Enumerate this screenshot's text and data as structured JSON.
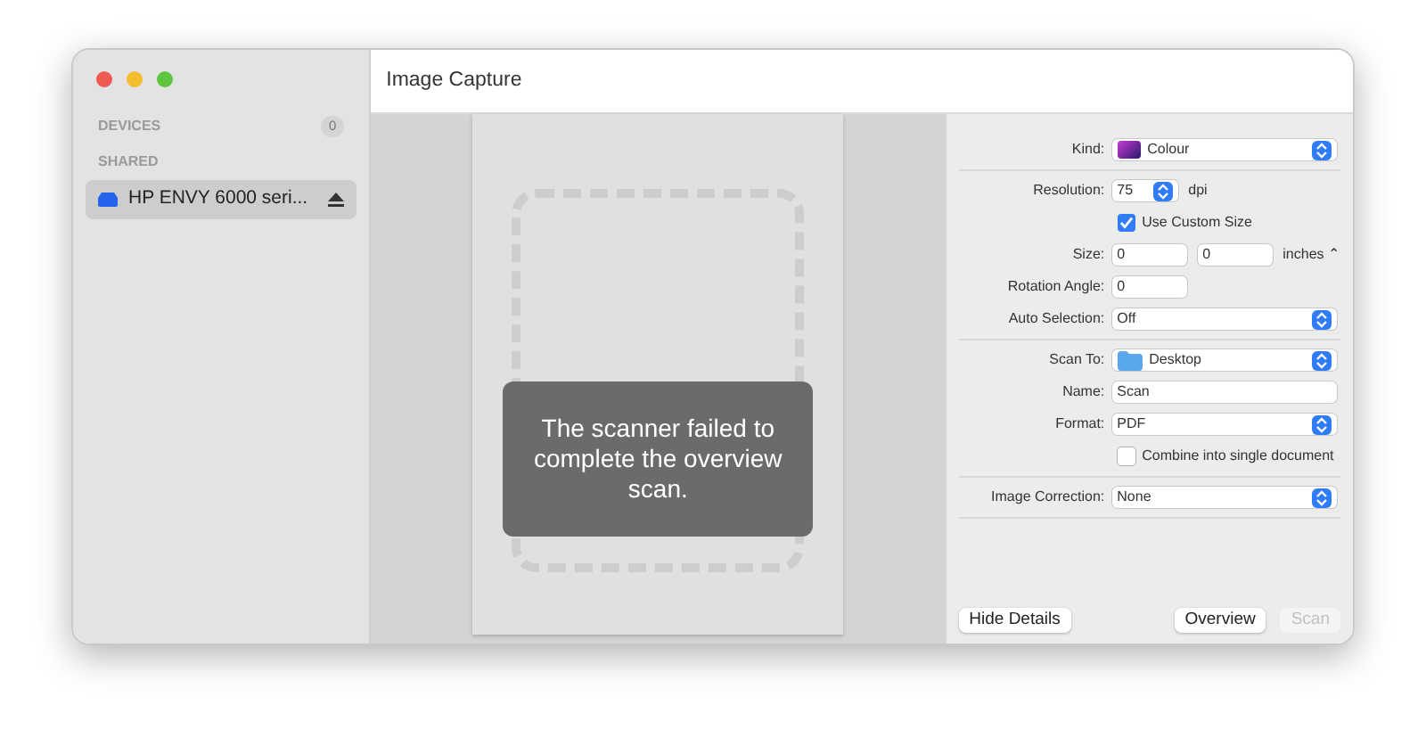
{
  "window": {
    "title": "Image Capture"
  },
  "sidebar": {
    "sections": [
      {
        "heading": "DEVICES",
        "count": "0"
      },
      {
        "heading": "SHARED",
        "items": [
          {
            "name": "HP ENVY 6000 seri...",
            "selected": true
          }
        ]
      }
    ]
  },
  "preview": {
    "message": "The scanner failed to complete the overview scan."
  },
  "settings": [
    [
      {
        "kind": "colour-popup",
        "label": "Kind:",
        "value": "Colour"
      }
    ],
    [
      {
        "kind": "stepper",
        "label": "Resolution:",
        "value": "75",
        "unit": "dpi"
      },
      {
        "kind": "checkbox",
        "text": "Use Custom Size",
        "checked": true
      },
      {
        "kind": "size",
        "label": "Size:",
        "values": [
          "0",
          "0"
        ],
        "unit": "inches ⌃"
      },
      {
        "kind": "short-text",
        "label": "Rotation Angle:",
        "value": "0"
      },
      {
        "kind": "popup",
        "label": "Auto Selection:",
        "value": "Off"
      }
    ],
    [
      {
        "kind": "folder-popup",
        "label": "Scan To:",
        "value": "Desktop"
      },
      {
        "kind": "text",
        "label": "Name:",
        "value": "Scan"
      },
      {
        "kind": "popup",
        "label": "Format:",
        "value": "PDF"
      },
      {
        "kind": "checkbox",
        "text": "Combine into single document",
        "checked": false
      }
    ],
    [
      {
        "kind": "popup",
        "label": "Image Correction:",
        "value": "None"
      }
    ]
  ],
  "buttons": {
    "left": [
      {
        "label": "Hide Details",
        "disabled": false
      }
    ],
    "right": [
      {
        "label": "Overview",
        "disabled": false
      },
      {
        "label": "Scan",
        "disabled": true
      }
    ]
  }
}
